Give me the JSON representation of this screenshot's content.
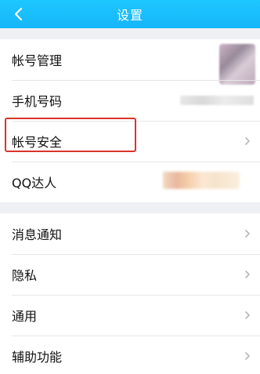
{
  "header": {
    "title": "设置",
    "back_icon": "back-chevron-icon"
  },
  "account": {
    "items": [
      {
        "label": "帐号管理",
        "icon": "avatar-blurred"
      },
      {
        "label": "手机号码",
        "icon": "blurred-phone-number"
      },
      {
        "label": "帐号安全",
        "icon": "chevron-right-icon"
      },
      {
        "label": "QQ达人",
        "icon": "blurred-badge"
      }
    ]
  },
  "general": {
    "items": [
      {
        "label": "消息通知",
        "icon": "chevron-right-icon"
      },
      {
        "label": "隐私",
        "icon": "chevron-right-icon"
      },
      {
        "label": "通用",
        "icon": "chevron-right-icon"
      },
      {
        "label": "辅助功能",
        "icon": "chevron-right-icon"
      }
    ]
  },
  "colors": {
    "header_bg": "#16b6f8",
    "highlight": "#d9342b",
    "page_bg": "#eef0f4",
    "chevron": "#b8b8b8"
  }
}
